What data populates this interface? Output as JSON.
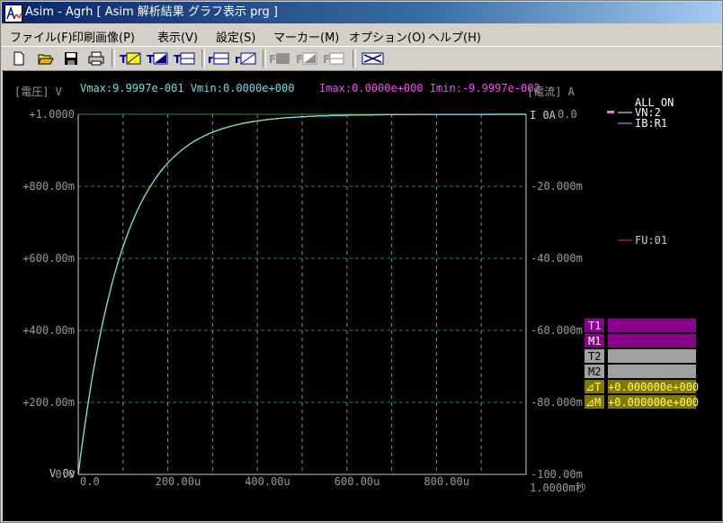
{
  "window": {
    "title": "Asim - Agrh [ Asim 解析結果  グラフ表示 prg  ]"
  },
  "menu": [
    {
      "label": "ファイル(F)"
    },
    {
      "label": "印刷画像(P)"
    },
    {
      "label": "表示(V)"
    },
    {
      "label": "設定(S)"
    },
    {
      "label": "マーカー(M)"
    },
    {
      "label": "オプション(O)"
    },
    {
      "label": "ヘルプ(H)"
    }
  ],
  "toolbar": {
    "t_label": "T",
    "r_label": "r",
    "f_label": "F",
    "icons": [
      "new-icon",
      "open-icon",
      "save-icon",
      "print-icon",
      "t-area-icon",
      "t-ramp-icon",
      "t-split-icon",
      "r-split-icon",
      "r-ramp-icon",
      "f-area-icon",
      "f-ramp-icon",
      "f-split-icon",
      "swap-icon"
    ]
  },
  "graph": {
    "left_axis_title": "[電圧] V",
    "right_axis_title": "[電流] A",
    "vmax_vmin": "Vmax:9.9997e-001 Vmin:0.0000e+000",
    "imax_imin": "Imax:0.0000e+000 Imin:-9.9997e-002",
    "left_ticks": [
      "+1.0000",
      "+800.00m",
      "+600.00m",
      "+400.00m",
      "+200.00m",
      "0.0"
    ],
    "right_ticks": [
      "0.0",
      "-20.000m",
      "-40.000m",
      "-60.000m",
      "-80.000m",
      "-100.00m"
    ],
    "right_zero_prefix": "I 0A",
    "bottom_left_label": "V 0v",
    "x_ticks": [
      "0.0",
      "200.00u",
      "400.00u",
      "600.00u",
      "800.00u"
    ],
    "x_end_label": "1.0000m秒",
    "colors": {
      "voltage": "#ffff66",
      "current": "#66e0e8",
      "grid": "#2e8b2e",
      "axis": "#cccccc",
      "fu": "#ff3030"
    }
  },
  "legend": {
    "all_on": "ALL ON",
    "vn": "VN:2",
    "ib": "IB:R1",
    "fu": "FU:01"
  },
  "markers": {
    "t1": "T1",
    "m1": "M1",
    "t2": "T2",
    "m2": "M2",
    "dt_label": "⊿T",
    "dt_value": "+0.000000e+000",
    "dm_label": "⊿M",
    "dm_value": "+0.000000e+000"
  },
  "chart_data": {
    "type": "line",
    "xlabel": "秒",
    "xlim": [
      0,
      0.001
    ],
    "ylim_left": [
      0,
      1.0
    ],
    "ylim_right": [
      -0.1,
      0.0
    ],
    "grid": true,
    "legend_position": "right",
    "series": [
      {
        "name": "VN:2",
        "axis": "left",
        "x": [
          0,
          5e-05,
          0.0001,
          0.00015,
          0.0002,
          0.0003,
          0.0004,
          0.0005,
          0.0006,
          0.0007,
          0.0008,
          0.0009,
          0.001
        ],
        "values": [
          0,
          0.39,
          0.63,
          0.78,
          0.865,
          0.95,
          0.982,
          0.993,
          0.9975,
          0.9991,
          0.9997,
          0.9999,
          0.99997
        ]
      },
      {
        "name": "IB:R1",
        "axis": "right",
        "x": [
          0,
          5e-05,
          0.0001,
          0.00015,
          0.0002,
          0.0003,
          0.0004,
          0.0005,
          0.0006,
          0.0007,
          0.0008,
          0.0009,
          0.001
        ],
        "values": [
          -0.099997,
          -0.061,
          -0.037,
          -0.022,
          -0.0135,
          -0.005,
          -0.0018,
          -0.0007,
          -0.00025,
          -9e-05,
          -3e-05,
          -1e-05,
          0.0
        ]
      }
    ]
  }
}
